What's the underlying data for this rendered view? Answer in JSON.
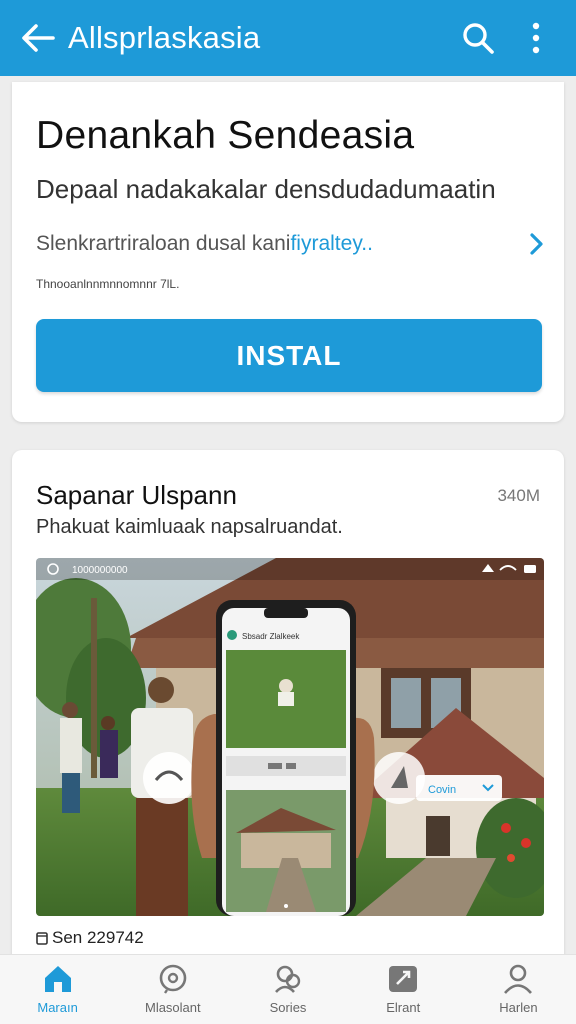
{
  "appbar": {
    "title": "Allsprlaskasia"
  },
  "app_card": {
    "title": "Denankah Sendeasia",
    "subtitle": "Depaal nadakakalar densdudadumaatin",
    "info_text": "Slenkrartriraloan dusal kani",
    "info_link": "fiyraltey..",
    "meta": "Thnooanlnnmnnomnnr 7lL.",
    "install_label": "INSTAL"
  },
  "preview_card": {
    "title": "Sapanar Ulspann",
    "size": "340M",
    "description": "Phakuat kaimluaak napsalruandat.",
    "screenshot": {
      "status_time": "1000000000",
      "phone_header": "Sbsadr Zlalkeek",
      "dropdown_label": "Covin"
    },
    "footer": "Sen 229742"
  },
  "bottom_nav": [
    {
      "label": "Maraın",
      "icon": "home-icon",
      "active": true
    },
    {
      "label": "Mlasolant",
      "icon": "discover-icon",
      "active": false
    },
    {
      "label": "Sories",
      "icon": "stories-icon",
      "active": false
    },
    {
      "label": "Elrant",
      "icon": "updates-icon",
      "active": false
    },
    {
      "label": "Harlen",
      "icon": "profile-icon",
      "active": false
    }
  ],
  "colors": {
    "accent": "#1e9ad8",
    "background": "#ededed",
    "card": "#ffffff"
  }
}
